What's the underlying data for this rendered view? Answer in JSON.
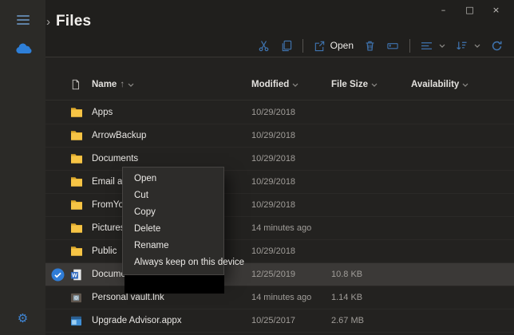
{
  "window": {
    "controls": {
      "minimize": "–",
      "maximize": "□",
      "close": "×"
    }
  },
  "sidebar": {
    "items": [
      {
        "name": "menu",
        "icon": "hamburger-icon"
      },
      {
        "name": "onedrive",
        "icon": "onedrive-cloud-icon"
      },
      {
        "name": "settings",
        "icon": "gear-icon",
        "glyph": "⚙"
      }
    ]
  },
  "header": {
    "back_chevron": "›",
    "title": "Files"
  },
  "toolbar": {
    "open_label": "Open",
    "icons": [
      "cut-icon",
      "copy-icon",
      "open-icon",
      "delete-icon",
      "rename-icon",
      "view-icon",
      "sort-icon",
      "refresh-icon"
    ]
  },
  "list": {
    "columns": [
      {
        "key": "name",
        "label": "Name",
        "sort_arrow": "↑"
      },
      {
        "key": "modified",
        "label": "Modified"
      },
      {
        "key": "size",
        "label": "File Size"
      },
      {
        "key": "availability",
        "label": "Availability"
      }
    ],
    "rows": [
      {
        "icon": "folder",
        "name": "Apps",
        "modified": "10/29/2018",
        "size": "",
        "availability": "",
        "selected": false
      },
      {
        "icon": "folder",
        "name": "ArrowBackup",
        "modified": "10/29/2018",
        "size": "",
        "availability": "",
        "selected": false
      },
      {
        "icon": "folder",
        "name": "Documents",
        "modified": "10/29/2018",
        "size": "",
        "availability": "",
        "selected": false
      },
      {
        "icon": "folder",
        "name": "Email atta",
        "modified": "10/29/2018",
        "size": "",
        "availability": "",
        "selected": false
      },
      {
        "icon": "folder",
        "name": "FromYour",
        "modified": "10/29/2018",
        "size": "",
        "availability": "",
        "selected": false
      },
      {
        "icon": "folder",
        "name": "Pictures",
        "modified": "14 minutes ago",
        "size": "",
        "availability": "",
        "selected": false
      },
      {
        "icon": "folder",
        "name": "Public",
        "modified": "10/29/2018",
        "size": "",
        "availability": "",
        "selected": false
      },
      {
        "icon": "word-doc",
        "name": "Documen",
        "modified": "12/25/2019",
        "size": "10.8 KB",
        "availability": "",
        "selected": true
      },
      {
        "icon": "vault",
        "name": "Personal vault.lnk",
        "modified": "14 minutes ago",
        "size": "1.14 KB",
        "availability": "",
        "selected": false
      },
      {
        "icon": "appx",
        "name": "Upgrade Advisor.appx",
        "modified": "10/25/2017",
        "size": "2.67 MB",
        "availability": "",
        "selected": false
      }
    ]
  },
  "context_menu": {
    "items": [
      "Open",
      "Cut",
      "Copy",
      "Delete",
      "Rename",
      "Always keep on this device"
    ]
  },
  "colors": {
    "accent_blue": "#3f74b0",
    "folder_yellow": "#f6c445",
    "check_blue": "#2f7cd6",
    "selection_bg": "#3b3937",
    "sidebar_bg": "#2b2a27",
    "content_bg": "#232220"
  }
}
